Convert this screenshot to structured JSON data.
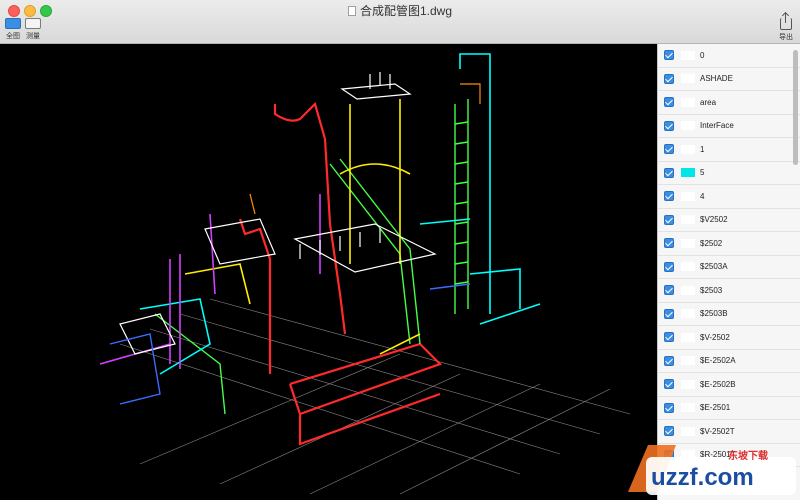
{
  "window": {
    "title": "合成配管图1.dwg"
  },
  "toolbar": {
    "full_label": "全图",
    "measure_label": "测量",
    "export_label": "导出"
  },
  "canvas": {
    "background": "#000000"
  },
  "layers": [
    {
      "name": "0",
      "color": "#ffffff",
      "checked": true
    },
    {
      "name": "ASHADE",
      "color": "#ffffff",
      "checked": true
    },
    {
      "name": "area",
      "color": "#ffffff",
      "checked": true
    },
    {
      "name": "InterFace",
      "color": "#ffffff",
      "checked": true
    },
    {
      "name": "1",
      "color": "#ffffff",
      "checked": true
    },
    {
      "name": "5",
      "color": "#00e5e5",
      "checked": true
    },
    {
      "name": "4",
      "color": "#ffffff",
      "checked": true
    },
    {
      "name": "$V2502",
      "color": "#ffffff",
      "checked": true
    },
    {
      "name": "$2502",
      "color": "#ffffff",
      "checked": true
    },
    {
      "name": "$2503A",
      "color": "#ffffff",
      "checked": true
    },
    {
      "name": "$2503",
      "color": "#ffffff",
      "checked": true
    },
    {
      "name": "$2503B",
      "color": "#ffffff",
      "checked": true
    },
    {
      "name": "$V-2502",
      "color": "#ffffff",
      "checked": true
    },
    {
      "name": "$E-2502A",
      "color": "#ffffff",
      "checked": true
    },
    {
      "name": "$E-2502B",
      "color": "#ffffff",
      "checked": true
    },
    {
      "name": "$E-2501",
      "color": "#ffffff",
      "checked": true
    },
    {
      "name": "$V-2502T",
      "color": "#ffffff",
      "checked": true
    },
    {
      "name": "$R-2501T",
      "color": "#ffffff",
      "checked": true
    }
  ],
  "watermark": {
    "text": "uzzf.com",
    "sub": "东坡下载"
  }
}
